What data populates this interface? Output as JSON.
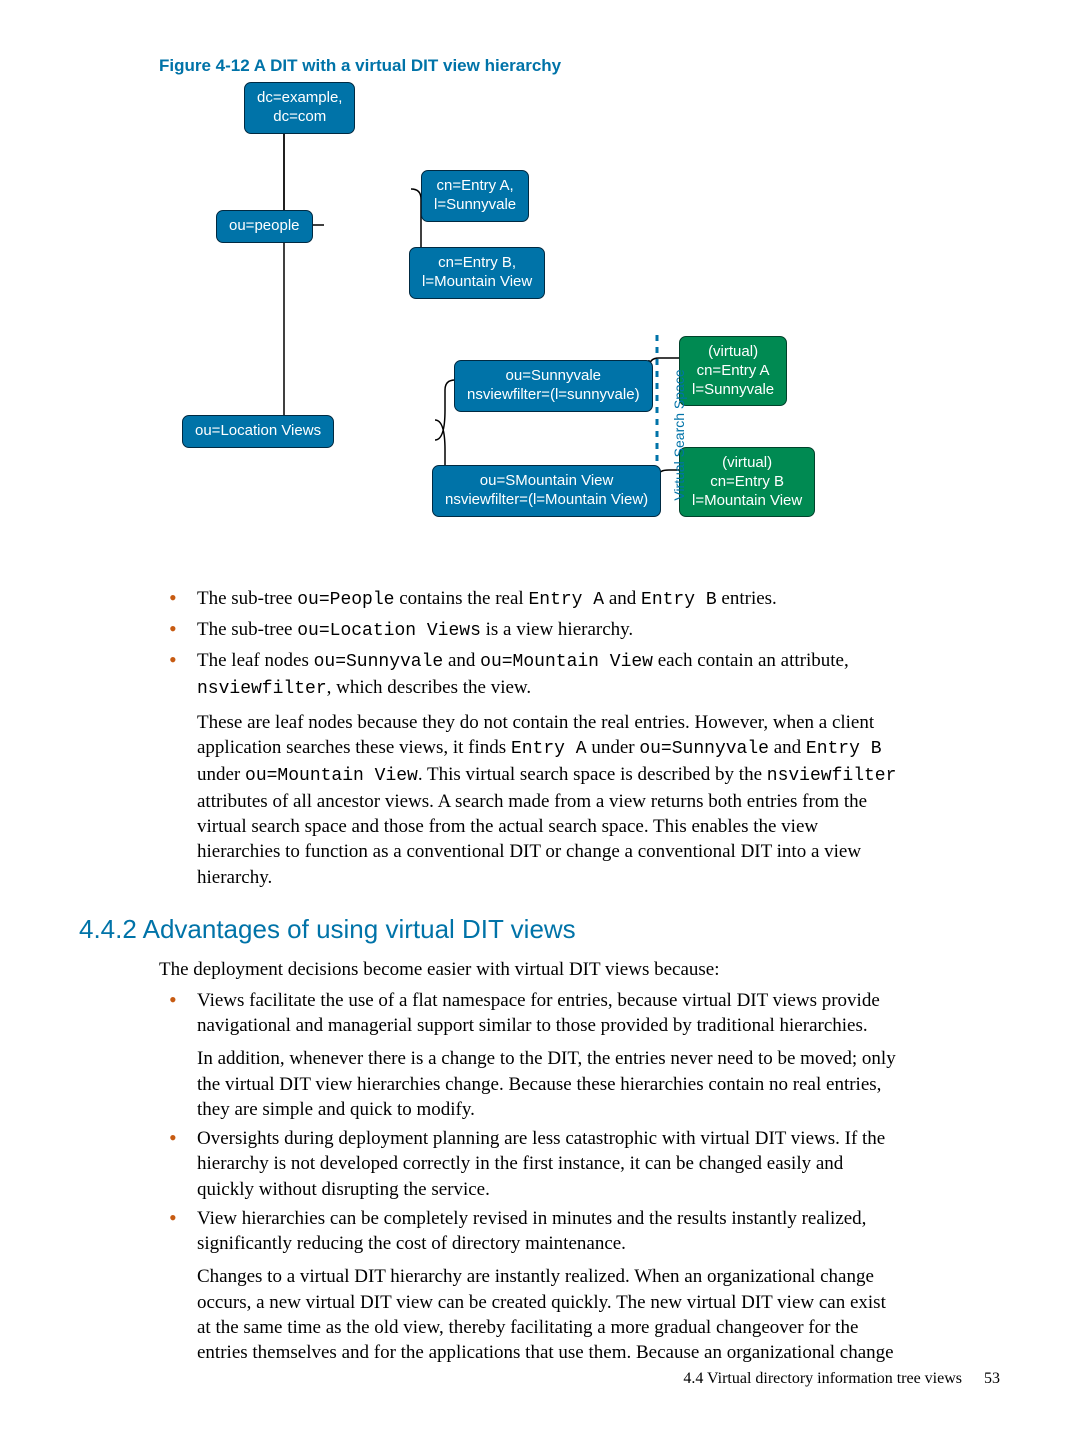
{
  "figure_caption": "Figure 4-12 A DIT with a virtual DIT view hierarchy",
  "diagram": {
    "root": "dc=example,\ndc=com",
    "people": "ou=people",
    "entryA": "cn=Entry A,\nl=Sunnyvale",
    "entryB": "cn=Entry B,\nl=Mountain View",
    "locviews": "ou=Location Views",
    "sunny": "ou=Sunnyvale\nnsviewfilter=(l=sunnyvale)",
    "mtn": "ou=SMountain View\nnsviewfilter=(l=Mountain View)",
    "virtA": "(virtual)\ncn=Entry A\nl=Sunnyvale",
    "virtB": "(virtual)\ncn=Entry B\nl=Mountain View",
    "vss": "Virtual Search Space"
  },
  "bullets1": {
    "b1_pre": "The sub-tree ",
    "b1_c1": "ou=People",
    "b1_mid1": " contains the real ",
    "b1_c2": "Entry A",
    "b1_mid2": " and ",
    "b1_c3": "Entry B",
    "b1_post": " entries.",
    "b2_pre": "The sub-tree ",
    "b2_c1": "ou=Location Views",
    "b2_post": " is a view hierarchy.",
    "b3_pre": "The leaf nodes ",
    "b3_c1": "ou=Sunnyvale",
    "b3_mid1": " and ",
    "b3_c2": "ou=Mountain View",
    "b3_mid2": " each contain an attribute, ",
    "b3_c3": "nsviewfilter",
    "b3_post": ", which describes the view.",
    "b3_p2a": "These are leaf nodes because they do not contain the real entries. However, when a client application searches these views, it finds ",
    "b3_p2c1": "Entry A",
    "b3_p2b": " under ",
    "b3_p2c2": "ou=Sunnyvale",
    "b3_p2c": " and ",
    "b3_p2c3": "Entry B",
    "b3_p2d": " under ",
    "b3_p2c4": "ou=Mountain View",
    "b3_p2e": ". This virtual search space is described by the ",
    "b3_p2c5": "nsviewfilter",
    "b3_p2f": " attributes of all ancestor views. A search made from a view returns both entries from the virtual search space and those from the actual search space. This enables the view hierarchies to function as a conventional DIT or change a conventional DIT into a view hierarchy."
  },
  "section_heading": "4.4.2 Advantages of using virtual DIT views",
  "section_intro": "The deployment decisions become easier with virtual DIT views because:",
  "bullets2": {
    "b1": "Views facilitate the use of a flat namespace for entries, because virtual DIT views provide navigational and managerial support similar to those provided by traditional hierarchies.",
    "b1p2": "In addition, whenever there is a change to the DIT, the entries never need to be moved; only the virtual DIT view hierarchies change. Because these hierarchies contain no real entries, they are simple and quick to modify.",
    "b2": "Oversights during deployment planning are less catastrophic with virtual DIT views. If the hierarchy is not developed correctly in the first instance, it can be changed easily and quickly without disrupting the service.",
    "b3": "View hierarchies can be completely revised in minutes and the results instantly realized, significantly reducing the cost of directory maintenance.",
    "b3p2": "Changes to a virtual DIT hierarchy are instantly realized. When an organizational change occurs, a new virtual DIT view can be created quickly. The new virtual DIT view can exist at the same time as the old view, thereby facilitating a more gradual changeover for the entries themselves and for the applications that use them. Because an organizational change"
  },
  "footer": {
    "section": "4.4 Virtual directory information tree views",
    "page": "53"
  }
}
